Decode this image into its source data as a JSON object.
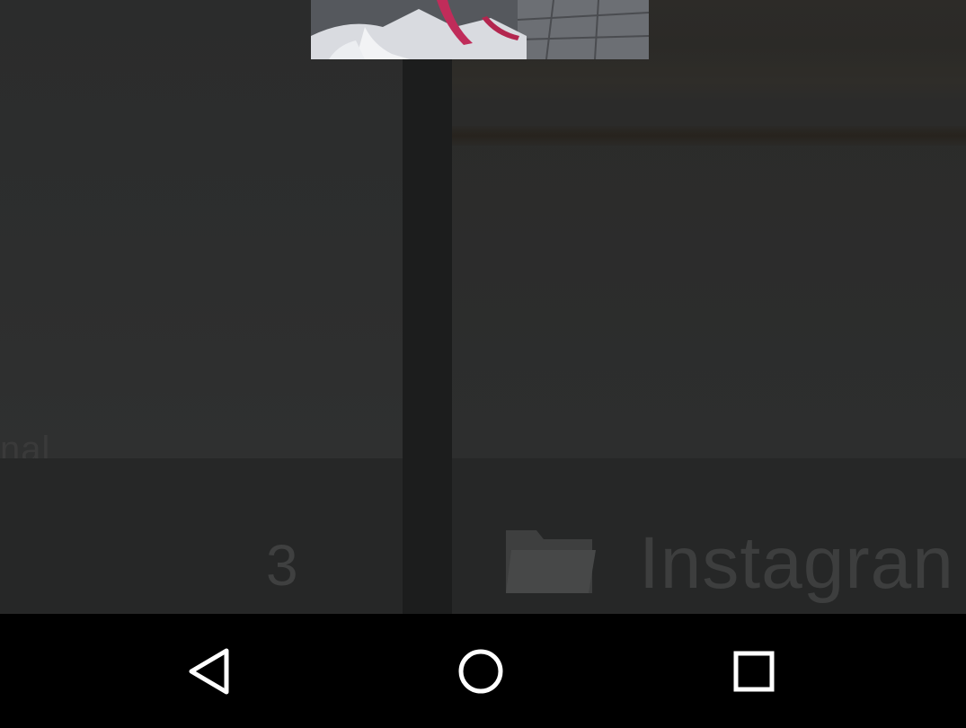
{
  "gallery": {
    "left_tile": {
      "partial_label": "nal",
      "count": "3"
    },
    "right_tile": {
      "album_name": "Instagran",
      "icon": "folder-icon"
    }
  },
  "navbar": {
    "back_icon": "back-icon",
    "home_icon": "home-icon",
    "recents_icon": "recents-icon"
  },
  "colors": {
    "navbar_bg": "#000000",
    "nav_icon": "#ffffff",
    "dim_surface": "#2c2d2d"
  }
}
